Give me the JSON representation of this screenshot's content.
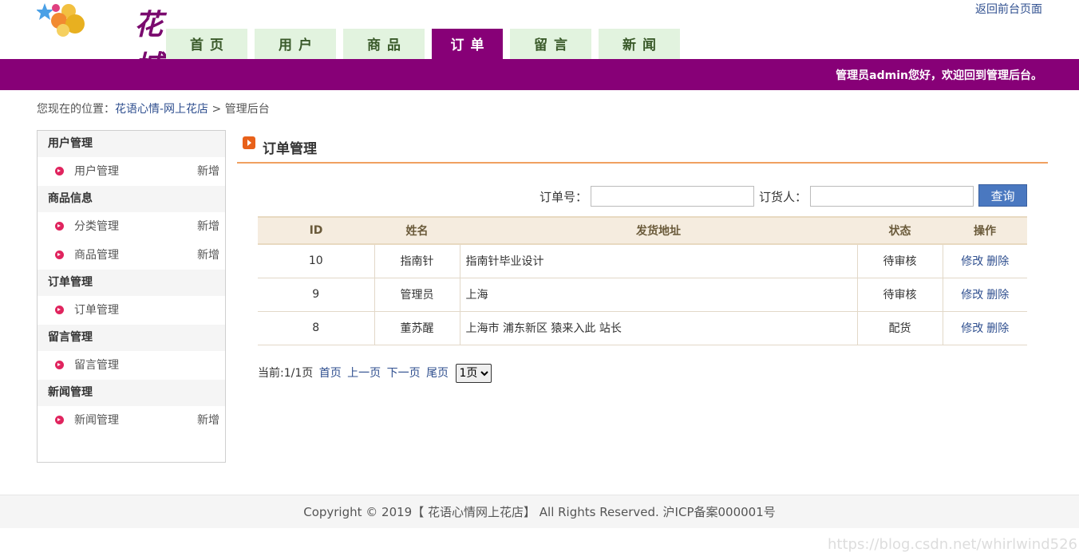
{
  "header": {
    "logo_text": "花城",
    "back_link": "返回前台页面",
    "welcome": "管理员admin您好，欢迎回到管理后台。"
  },
  "nav": {
    "tabs": [
      {
        "label": "首页"
      },
      {
        "label": "用户"
      },
      {
        "label": "商品"
      },
      {
        "label": "订单",
        "active": true
      },
      {
        "label": "留言"
      },
      {
        "label": "新闻"
      }
    ]
  },
  "breadcrumb": {
    "prefix": "您现在的位置：",
    "site": "花语心情-网上花店",
    "sep": ">",
    "current": "管理后台"
  },
  "sidebar": {
    "groups": [
      {
        "title": "用户管理",
        "items": [
          {
            "label": "用户管理",
            "add": "新增"
          }
        ]
      },
      {
        "title": "商品信息",
        "items": [
          {
            "label": "分类管理",
            "add": "新增"
          },
          {
            "label": "商品管理",
            "add": "新增"
          }
        ]
      },
      {
        "title": "订单管理",
        "items": [
          {
            "label": "订单管理"
          }
        ]
      },
      {
        "title": "留言管理",
        "items": [
          {
            "label": "留言管理"
          }
        ]
      },
      {
        "title": "新闻管理",
        "items": [
          {
            "label": "新闻管理",
            "add": "新增"
          }
        ]
      }
    ]
  },
  "main": {
    "title": "订单管理",
    "search": {
      "order_no_label": "订单号：",
      "order_no_value": "",
      "buyer_label": "订货人：",
      "buyer_value": "",
      "button": "查询"
    },
    "table": {
      "headers": [
        "ID",
        "姓名",
        "发货地址",
        "状态",
        "操作"
      ],
      "rows": [
        {
          "id": "10",
          "name": "指南针",
          "address": "指南针毕业设计",
          "status": "待审核",
          "edit": "修改",
          "delete": "删除"
        },
        {
          "id": "9",
          "name": "管理员",
          "address": "上海",
          "status": "待审核",
          "edit": "修改",
          "delete": "删除"
        },
        {
          "id": "8",
          "name": "董苏醒",
          "address": "上海市 浦东新区 猿来入此 站长",
          "status": "配货",
          "edit": "修改",
          "delete": "删除"
        }
      ]
    },
    "pager": {
      "current": "当前:1/1页",
      "first": "首页",
      "prev": "上一页",
      "next": "下一页",
      "last": "尾页",
      "select_value": "1页"
    }
  },
  "footer": {
    "copyright": "Copyright © 2019【 花语心情网上花店】 All Rights Reserved. 沪ICP备案000001号"
  },
  "watermark": "https://blog.csdn.net/whirlwind526",
  "colors": {
    "brand_purple": "#870077",
    "tab_bg": "#e2f3df",
    "title_underline": "#f0a060",
    "link": "#2f4f8f",
    "search_button": "#4a78c0"
  }
}
